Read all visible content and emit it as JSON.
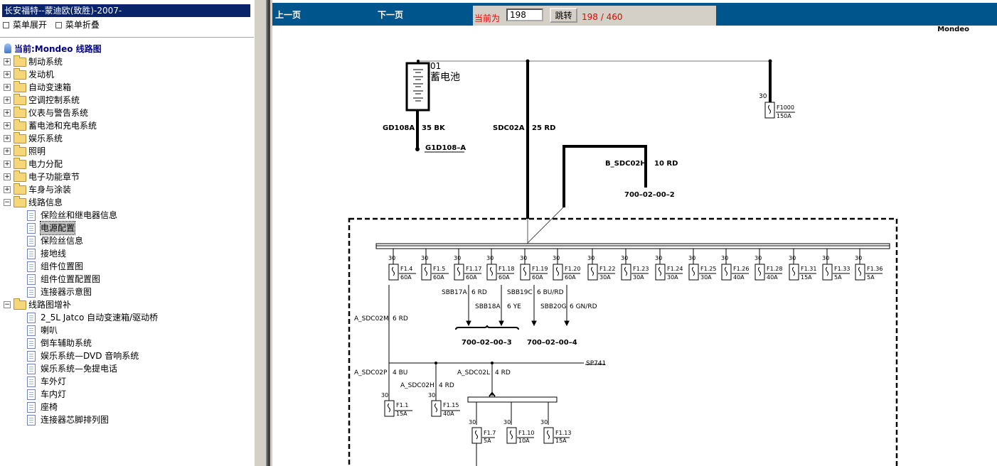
{
  "left_panel": {
    "title": "长安福特--蒙迪欧(致胜)-2007-",
    "expand_all": "菜单展开",
    "collapse_all": "菜单折叠",
    "current": "当前:Mondeo 线路图",
    "folders_top": [
      "制动系统",
      "发动机",
      "自动变速箱",
      "空调控制系统",
      "仪表与警告系统",
      "蓄电池和充电系统",
      "娱乐系统",
      "照明",
      "电力分配",
      "电子功能章节",
      "车身与涂装"
    ],
    "folder_wiring_info": "线路信息",
    "wiring_info_items": [
      "保险丝和继电器信息",
      "电源配置",
      "保险丝信息",
      "接地线",
      "组件位置图",
      "组件位置配置图",
      "连接器示意图"
    ],
    "selected_item": "电源配置",
    "folder_supplement": "线路图增补",
    "supplement_items": [
      "2_5L Jatco 自动变速箱/驱动桥",
      "喇叭",
      "倒车辅助系统",
      "娱乐系统—DVD 音响系统",
      "娱乐系统—免提电话",
      "车外灯",
      "车内灯",
      "座椅",
      "连接器芯脚排列图"
    ]
  },
  "nav": {
    "prev": "上一页",
    "next": "下一页",
    "current_label": "当前为",
    "page_input": "198",
    "go": "跳转",
    "page_count": "198 / 460"
  },
  "diagram": {
    "model": "Mondeo",
    "battery_num": "01",
    "battery_label": "蓄电池",
    "battery_ground_wire": "GD108A",
    "battery_ground_spec": "35 BK",
    "ground_point": "G1D108–A",
    "main_wire": "SDC02A",
    "main_wire_spec": "25 RD",
    "f1000_pin": "30",
    "f1000_name": "F1000",
    "f1000_rating": "150A",
    "b_wire": "B_SDC02H",
    "b_wire_spec": "10 RD",
    "ref_page_2": "700–02–00–2",
    "fuses": [
      {
        "name": "F1.4",
        "rating": "60A"
      },
      {
        "name": "F1.5",
        "rating": "60A"
      },
      {
        "name": "F1.17",
        "rating": "60A"
      },
      {
        "name": "F1.18",
        "rating": "60A"
      },
      {
        "name": "F1.19",
        "rating": "60A"
      },
      {
        "name": "F1.20",
        "rating": "60A"
      },
      {
        "name": "F1.22",
        "rating": "30A"
      },
      {
        "name": "F1.23",
        "rating": "30A"
      },
      {
        "name": "F1.24",
        "rating": "30A"
      },
      {
        "name": "F1.25",
        "rating": "30A"
      },
      {
        "name": "F1.26",
        "rating": "40A"
      },
      {
        "name": "F1.28",
        "rating": "40A"
      },
      {
        "name": "F1.31",
        "rating": "15A"
      },
      {
        "name": "F1.33",
        "rating": "5A"
      },
      {
        "name": "F1.36",
        "rating": "5A"
      }
    ],
    "pin": "30",
    "wire_sbb17a": "SBB17A",
    "wire_sbb17a_spec": "6 RD",
    "wire_sbb19c": "SBB19C",
    "wire_sbb19c_spec": "6 BU/RD",
    "wire_sbb18a": "SBB18A",
    "wire_sbb18a_spec": "6 YE",
    "wire_sbb20g": "SBB20G",
    "wire_sbb20g_spec": "6 GN/RD",
    "ref_page_3": "700–02–00–3",
    "ref_page_4": "700–02–00–4",
    "wire_a_sdc02m": "A_SDC02M",
    "wire_a_sdc02m_spec": "6 RD",
    "wire_a_sdc02p": "A_SDC02P",
    "wire_a_sdc02p_spec": "4 BU",
    "wire_a_sdc02l": "A_SDC02L",
    "wire_a_sdc02l_spec": "4 RD",
    "splice": "SP741",
    "wire_a_sdc02h": "A_SDC02H",
    "wire_a_sdc02h_spec": "4 RD",
    "fuse_f11": {
      "name": "F1.1",
      "rating": "15A"
    },
    "fuse_f115": {
      "name": "F1.15",
      "rating": "40A"
    },
    "fuse_f17": {
      "name": "F1.7",
      "rating": "5A"
    },
    "fuse_f110": {
      "name": "F1.10",
      "rating": "10A"
    },
    "fuse_f113": {
      "name": "F1.13",
      "rating": "15A"
    }
  }
}
